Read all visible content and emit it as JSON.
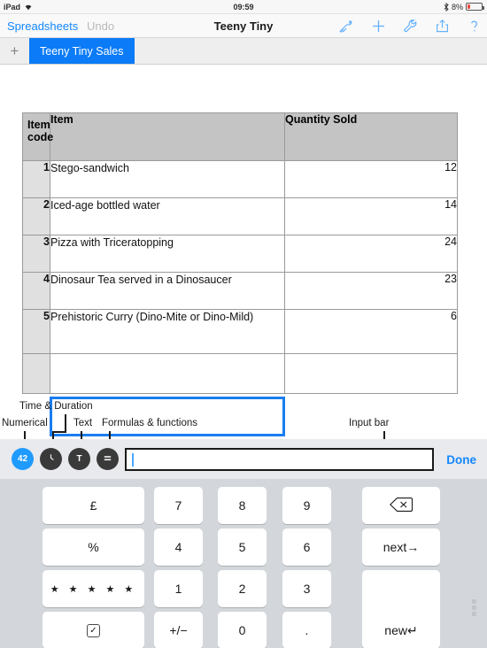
{
  "status_bar": {
    "device": "iPad",
    "wifi_icon": "wifi-icon",
    "time": "09:59",
    "bluetooth_icon": "bluetooth-icon",
    "battery_percent": "8%",
    "battery_icon": "battery-low-icon",
    "battery_color": "#ec4a3c"
  },
  "nav_bar": {
    "back_label": "Spreadsheets",
    "undo_label": "Undo",
    "title": "Teeny Tiny",
    "accent_color": "#1387ff",
    "icons": [
      {
        "name": "format-brush-icon",
        "label": "Format"
      },
      {
        "name": "plus-icon",
        "label": "Insert"
      },
      {
        "name": "wrench-icon",
        "label": "Tools"
      },
      {
        "name": "share-icon",
        "label": "Share"
      },
      {
        "name": "help-icon",
        "label": "Help"
      }
    ]
  },
  "tab_bar": {
    "add_label": "+",
    "tabs": [
      {
        "label": "Teeny Tiny Sales",
        "active": true
      }
    ],
    "active_color": "#0b7bf7"
  },
  "table": {
    "headers": [
      "Item code",
      "Item",
      "Quantity Sold"
    ],
    "header_code_line1": "Item",
    "header_code_line2": "code",
    "rows": [
      {
        "code": "1",
        "item": "Stego-sandwich",
        "qty": "12"
      },
      {
        "code": "2",
        "item": "Iced-age bottled water",
        "qty": "14"
      },
      {
        "code": "3",
        "item": "Pizza with Triceratopping",
        "qty": "24"
      },
      {
        "code": "4",
        "item": "Dinosaur Tea served in a Dinosaucer",
        "qty": "23"
      },
      {
        "code": "5",
        "item": "Prehistoric Curry (Dino-Mite or Dino-Mild)",
        "qty": "6"
      }
    ],
    "empty_row": {
      "code": "",
      "item": "",
      "qty": ""
    },
    "selection_color": "#1a7ef0"
  },
  "annotations": [
    {
      "id": "numerical",
      "label": "Numerical"
    },
    {
      "id": "time_duration",
      "label": "Time & Duration"
    },
    {
      "id": "text",
      "label": "Text"
    },
    {
      "id": "formulas",
      "label": "Formulas & functions"
    },
    {
      "id": "input_bar",
      "label": "Input bar"
    }
  ],
  "input_bar": {
    "type_buttons": [
      {
        "name": "numerical-type-button",
        "glyph": "42",
        "selected": true
      },
      {
        "name": "time-duration-type-button",
        "glyph": "clock-icon",
        "selected": false
      },
      {
        "name": "text-type-button",
        "glyph": "T",
        "selected": false
      },
      {
        "name": "formula-type-button",
        "glyph": "=",
        "selected": false
      }
    ],
    "value": "",
    "placeholder": "",
    "done_label": "Done",
    "selected_color": "#1f9bff"
  },
  "keyboard": {
    "keys": [
      {
        "label": "£",
        "name": "key-pound",
        "row": 1,
        "col": 1
      },
      {
        "label": "7",
        "name": "key-7",
        "row": 1,
        "col": 2
      },
      {
        "label": "8",
        "name": "key-8",
        "row": 1,
        "col": 3
      },
      {
        "label": "9",
        "name": "key-9",
        "row": 1,
        "col": 4
      },
      {
        "label": "backspace-icon",
        "name": "key-backspace",
        "row": 1,
        "col": 5
      },
      {
        "label": "%",
        "name": "key-percent",
        "row": 2,
        "col": 1
      },
      {
        "label": "4",
        "name": "key-4",
        "row": 2,
        "col": 2
      },
      {
        "label": "5",
        "name": "key-5",
        "row": 2,
        "col": 3
      },
      {
        "label": "6",
        "name": "key-6",
        "row": 2,
        "col": 4
      },
      {
        "label": "next→",
        "name": "key-next",
        "row": 2,
        "col": 5
      },
      {
        "label": "★ ★ ★ ★ ★",
        "name": "key-rating",
        "row": 3,
        "col": 1
      },
      {
        "label": "1",
        "name": "key-1",
        "row": 3,
        "col": 2
      },
      {
        "label": "2",
        "name": "key-2",
        "row": 3,
        "col": 3
      },
      {
        "label": "3",
        "name": "key-3",
        "row": 3,
        "col": 4
      },
      {
        "label": "new↵",
        "name": "key-new",
        "row": 3,
        "col": 5
      },
      {
        "label": "checkbox-icon",
        "name": "key-checkbox",
        "row": 4,
        "col": 1
      },
      {
        "label": "+/−",
        "name": "key-plusminus",
        "row": 4,
        "col": 2
      },
      {
        "label": "0",
        "name": "key-0",
        "row": 4,
        "col": 3
      },
      {
        "label": ".",
        "name": "key-decimal",
        "row": 4,
        "col": 4
      }
    ],
    "pound_label": "£",
    "percent_label": "%",
    "stars_label": "★ ★ ★ ★ ★",
    "plusminus_label": "+/−",
    "decimal_label": ".",
    "next_label": "next→",
    "new_label": "new↵",
    "digit_7": "7",
    "digit_8": "8",
    "digit_9": "9",
    "digit_4": "4",
    "digit_5": "5",
    "digit_6": "6",
    "digit_1": "1",
    "digit_2": "2",
    "digit_3": "3",
    "digit_0": "0",
    "checkmark": "✓",
    "background_color": "#d3d7db"
  }
}
